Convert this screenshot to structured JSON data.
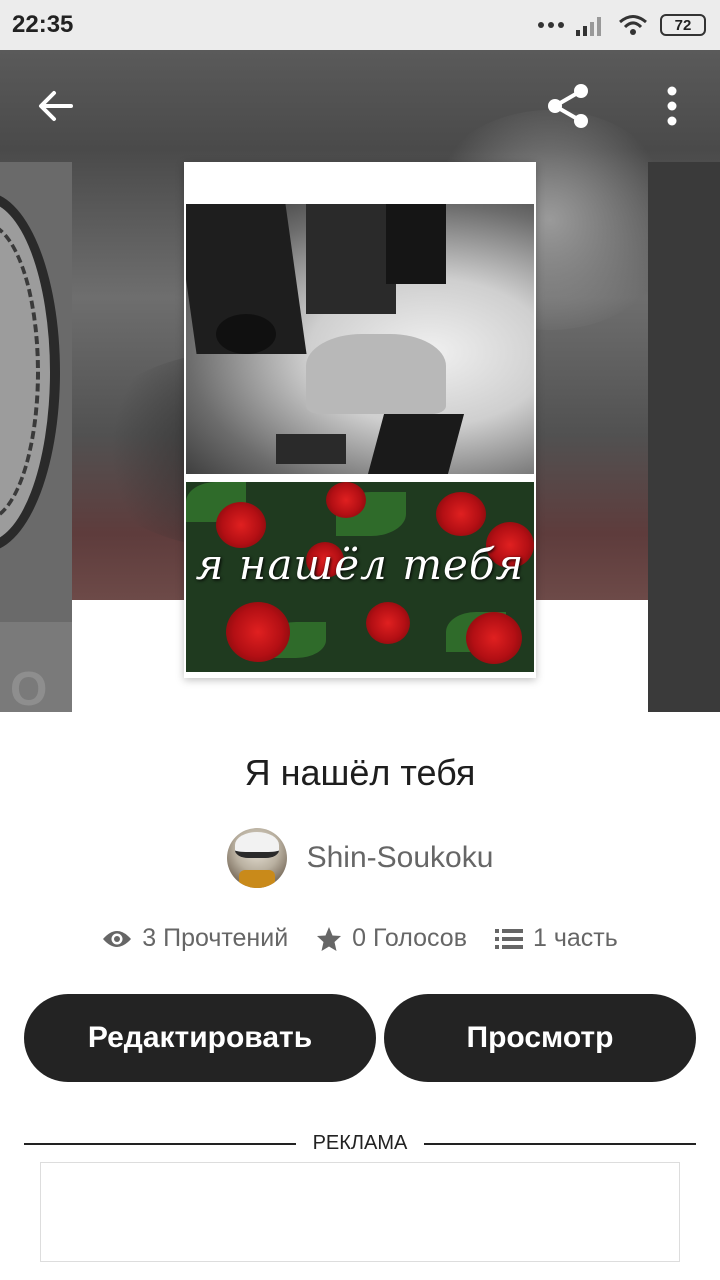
{
  "status_bar": {
    "time": "22:35",
    "battery": "72"
  },
  "story": {
    "cover_text": "я нашёл тебя",
    "title": "Я нашёл тебя",
    "author": "Shin-Soukoku",
    "side_left_letter": "O"
  },
  "stats": {
    "reads": "3 Прочтений",
    "votes": "0 Голосов",
    "parts": "1 часть"
  },
  "actions": {
    "edit": "Редактировать",
    "view": "Просмотр"
  },
  "ad": {
    "label": "РЕКЛАМА"
  },
  "icons": {
    "back": "arrow-left-icon",
    "share": "share-icon",
    "more": "more-vert-icon"
  },
  "colors": {
    "button_bg": "#232323",
    "text_gray": "#666666"
  }
}
